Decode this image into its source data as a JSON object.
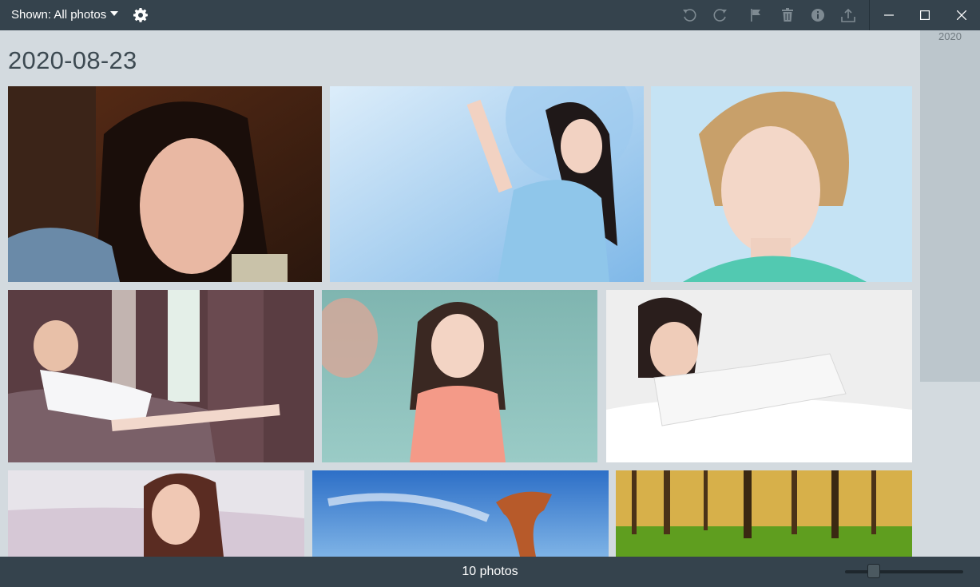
{
  "toolbar": {
    "filter_label": "Shown: All photos",
    "icons": [
      "gear-icon",
      "rotate-left-icon",
      "rotate-right-icon",
      "flag-icon",
      "trash-icon",
      "info-icon",
      "share-icon",
      "minimize-icon",
      "maximize-icon",
      "close-icon"
    ]
  },
  "timeline": {
    "year": "2020"
  },
  "gallery": {
    "date": "2020-08-23",
    "photos": [
      {
        "subject": "woman-resting-chin-on-hand"
      },
      {
        "subject": "woman-in-blue-dress"
      },
      {
        "subject": "blonde-woman-portrait"
      },
      {
        "subject": "woman-on-sofa"
      },
      {
        "subject": "woman-in-pool"
      },
      {
        "subject": "woman-on-white-bed"
      },
      {
        "subject": "woman-in-flower-field"
      },
      {
        "subject": "rock-formation-blue-sky"
      },
      {
        "subject": "green-forest"
      }
    ]
  },
  "footer": {
    "count_label": "10 photos",
    "zoom_level": 0.25
  },
  "colors": {
    "bar": "#35434d",
    "background": "#d3dadf",
    "timeline": "#bcc6cc"
  }
}
